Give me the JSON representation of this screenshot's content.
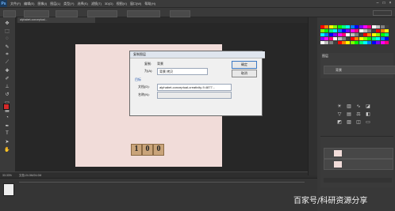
{
  "app": {
    "logo_text": "Ps"
  },
  "menubar": {
    "items": [
      "文件(F)",
      "编辑(E)",
      "图像(I)",
      "图层(L)",
      "类型(Y)",
      "选择(S)",
      "滤镜(T)",
      "3D(D)",
      "视图(V)",
      "窗口(W)",
      "帮助(H)"
    ]
  },
  "document": {
    "tab_label": "alphabet-conceptual...",
    "status_zoom": "33.33%",
    "status_info": "文档:24.0M/24.0M"
  },
  "canvas": {
    "tiles": [
      "1",
      "0",
      "0"
    ]
  },
  "dialog": {
    "title": "复制图层",
    "copy_label": "复制:",
    "copy_value": "背景",
    "as_label": "为(A):",
    "as_value": "背景 拷贝",
    "target_group": "目标",
    "document_label": "文档(D):",
    "document_value": "alphabet-conceptual-creativity-9.4877...",
    "name_label": "名称(N):",
    "ok_label": "确定",
    "cancel_label": "取消"
  },
  "layers_panel": {
    "tab": "图层",
    "layer_name": "背景"
  },
  "watermark": "百家号/科研资源分享",
  "colors": {
    "foreground": "#d42a2a",
    "background": "#ffffff"
  }
}
